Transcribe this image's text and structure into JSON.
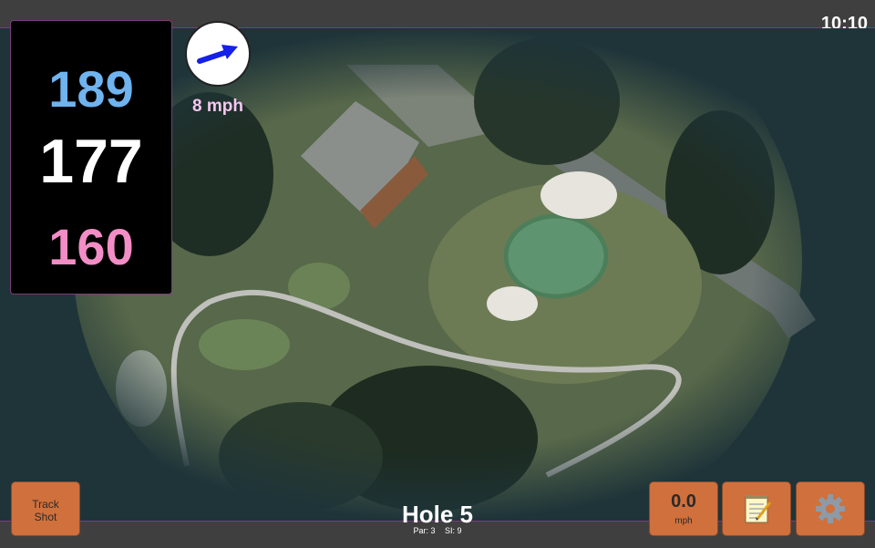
{
  "status_bar": {
    "time": "10:10"
  },
  "distances": {
    "back": "189",
    "center": "177",
    "front": "160"
  },
  "wind": {
    "speed": "8 mph",
    "icon": "wind-arrow-icon"
  },
  "hole": {
    "title": "Hole 5",
    "par": "Par: 3",
    "si": "SI: 9"
  },
  "buttons": {
    "track_shot_line1": "Track",
    "track_shot_line2": "Shot",
    "speed_value": "0.0",
    "speed_unit": "mph",
    "notes_icon": "notepad-icon",
    "settings_icon": "gear-icon"
  },
  "colors": {
    "back_distance": "#6fb3ef",
    "center_distance": "#ffffff",
    "front_distance": "#f28dc6",
    "button": "#d0703c",
    "accent_line": "#7a3d7a"
  }
}
